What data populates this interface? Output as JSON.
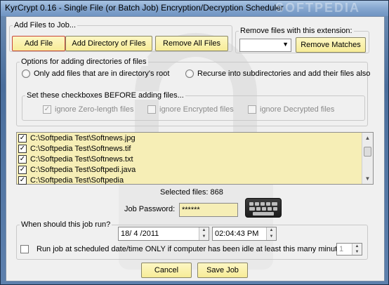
{
  "window": {
    "title": "KyrCrypt 0.16 - Single File (or Batch Job) Encryption/Decryption Scheduler",
    "watermark": "SOFTPEDIA"
  },
  "add_files": {
    "legend": "Add Files to Job...",
    "add_file": "Add File",
    "add_directory": "Add Directory of Files",
    "remove_all": "Remove All Files"
  },
  "remove_ext": {
    "legend": "Remove files with this extension:",
    "selected": "",
    "remove_matches": "Remove Matches"
  },
  "dir_options": {
    "legend": "Options for adding directories of files",
    "only_root": "Only add files that are in directory's root",
    "recurse": "Recurse into subdirectories and add their files also"
  },
  "checkbox_group": {
    "legend": "Set these checkboxes BEFORE adding files...",
    "ignore_zero": "ignore Zero-length files",
    "ignore_encrypted": "ignore Encrypted files",
    "ignore_decrypted": "ignore Decrypted files"
  },
  "file_list": [
    "C:\\Softpedia Test\\Softnews.jpg",
    "C:\\Softpedia Test\\Softnews.tif",
    "C:\\Softpedia Test\\Softnews.txt",
    "C:\\Softpedia Test\\Softpedi.java",
    "C:\\Softpedia Test\\Softpedia"
  ],
  "selected_files": "Selected files: 868",
  "password": {
    "label": "Job Password:",
    "value": "******"
  },
  "schedule": {
    "legend": "When should this job run?",
    "date": "18/ 4 /2011",
    "time": "02:04:43 PM",
    "idle_label": "Run job at scheduled date/time ONLY if computer has been idle at least this many minutes:",
    "idle_minutes": "1"
  },
  "actions": {
    "cancel": "Cancel",
    "save": "Save Job"
  }
}
